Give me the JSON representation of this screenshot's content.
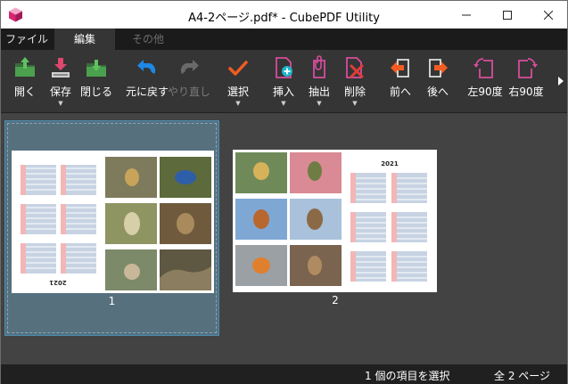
{
  "window": {
    "title": "A4-2ページ.pdf* - CubePDF Utility",
    "minimize": "—",
    "maximize": "☐",
    "close": "✕"
  },
  "tabs": [
    {
      "label": "ファイル",
      "state": "normal"
    },
    {
      "label": "編集",
      "state": "selected"
    },
    {
      "label": "その他",
      "state": "disabled"
    }
  ],
  "toolbar": {
    "buttons": [
      {
        "label": "開く",
        "icon": "open-icon",
        "has_dropdown": false,
        "enabled": true
      },
      {
        "label": "保存",
        "icon": "save-icon",
        "has_dropdown": true,
        "enabled": true
      },
      {
        "label": "閉じる",
        "icon": "close-document-icon",
        "has_dropdown": false,
        "enabled": true
      },
      {
        "label": "元に戻す",
        "icon": "undo-icon",
        "has_dropdown": false,
        "enabled": true
      },
      {
        "label": "やり直し",
        "icon": "redo-icon",
        "has_dropdown": false,
        "enabled": false
      },
      {
        "label": "選択",
        "icon": "select-check-icon",
        "has_dropdown": true,
        "enabled": true
      },
      {
        "label": "挿入",
        "icon": "insert-icon",
        "has_dropdown": true,
        "enabled": true
      },
      {
        "label": "抽出",
        "icon": "extract-icon",
        "has_dropdown": true,
        "enabled": true
      },
      {
        "label": "削除",
        "icon": "delete-icon",
        "has_dropdown": true,
        "enabled": true
      },
      {
        "label": "前へ",
        "icon": "move-previous-icon",
        "has_dropdown": false,
        "enabled": true
      },
      {
        "label": "後へ",
        "icon": "move-next-icon",
        "has_dropdown": false,
        "enabled": true
      },
      {
        "label": "左90度",
        "icon": "rotate-left-icon",
        "has_dropdown": false,
        "enabled": true
      },
      {
        "label": "右90度",
        "icon": "rotate-right-icon",
        "has_dropdown": false,
        "enabled": true
      }
    ],
    "dropdown_glyph": "▼",
    "overflow_icon": "chevron-right-icon"
  },
  "pages": [
    {
      "number": "1",
      "selected": true,
      "orientation": "rotated-180",
      "year_label": "2021"
    },
    {
      "number": "2",
      "selected": false,
      "orientation": "normal",
      "year_label": "2021"
    }
  ],
  "status": {
    "selection": "1 個の項目を選択",
    "total": "全 2 ページ"
  },
  "colors": {
    "accent_green": "#3fae49",
    "accent_pink": "#e0476f",
    "accent_blue": "#1e88e5",
    "accent_orange": "#f25c22",
    "accent_magenta": "#d64d9c",
    "selection_fill": "#56707e",
    "selection_border": "#4a8db0"
  }
}
